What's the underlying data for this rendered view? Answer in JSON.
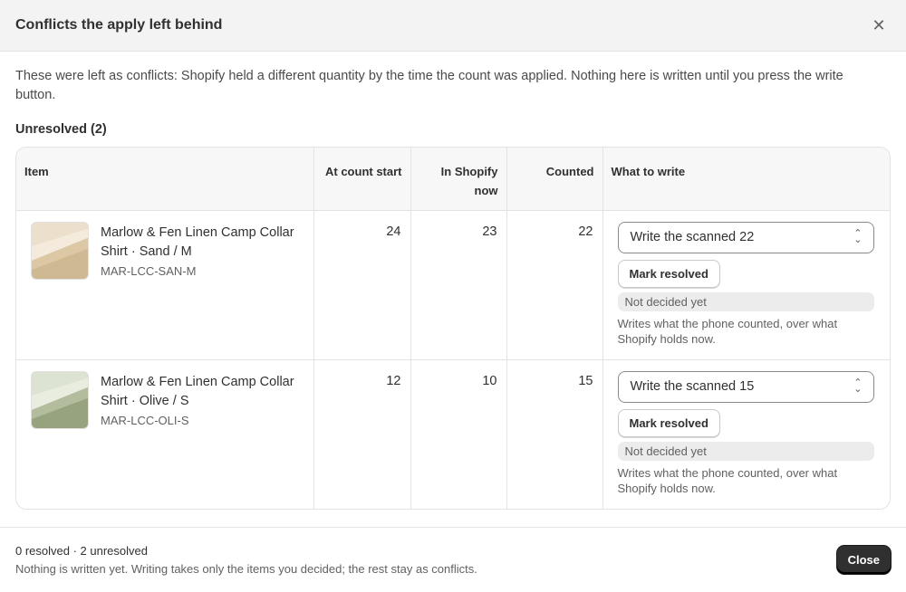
{
  "modal": {
    "title": "Conflicts the apply left behind",
    "close_icon": "close-icon"
  },
  "intro": "These were left as conflicts: Shopify held a different quantity by the time the count was applied. Nothing here is written until you press the write button.",
  "section_label": "Unresolved (2)",
  "table": {
    "headers": {
      "item": "Item",
      "at_count_start": "At count start",
      "in_shopify_now": "In Shopify now",
      "counted": "Counted",
      "what_to_write": "What to write"
    },
    "rows": [
      {
        "name": "Marlow & Fen Linen Camp Collar Shirt · Sand / M",
        "sku": "MAR-LCC-SAN-M",
        "thumb_color": "#d2bd96",
        "at_count_start": "24",
        "in_shopify_now": "23",
        "counted": "22",
        "write_choice": "Write the scanned 22",
        "resolve_label": "Mark resolved",
        "status": "Not decided yet",
        "helper": "Writes what the phone counted, over what Shopify holds now."
      },
      {
        "name": "Marlow & Fen Linen Camp Collar Shirt · Olive / S",
        "sku": "MAR-LCC-OLI-S",
        "thumb_color": "#9aa683",
        "at_count_start": "12",
        "in_shopify_now": "10",
        "counted": "15",
        "write_choice": "Write the scanned 15",
        "resolve_label": "Mark resolved",
        "status": "Not decided yet",
        "helper": "Writes what the phone counted, over what Shopify holds now."
      }
    ]
  },
  "footer": {
    "summary": "0 resolved · 2 unresolved",
    "note": "Nothing is written yet. Writing takes only the items you decided; the rest stay as conflicts.",
    "close_label": "Close"
  }
}
